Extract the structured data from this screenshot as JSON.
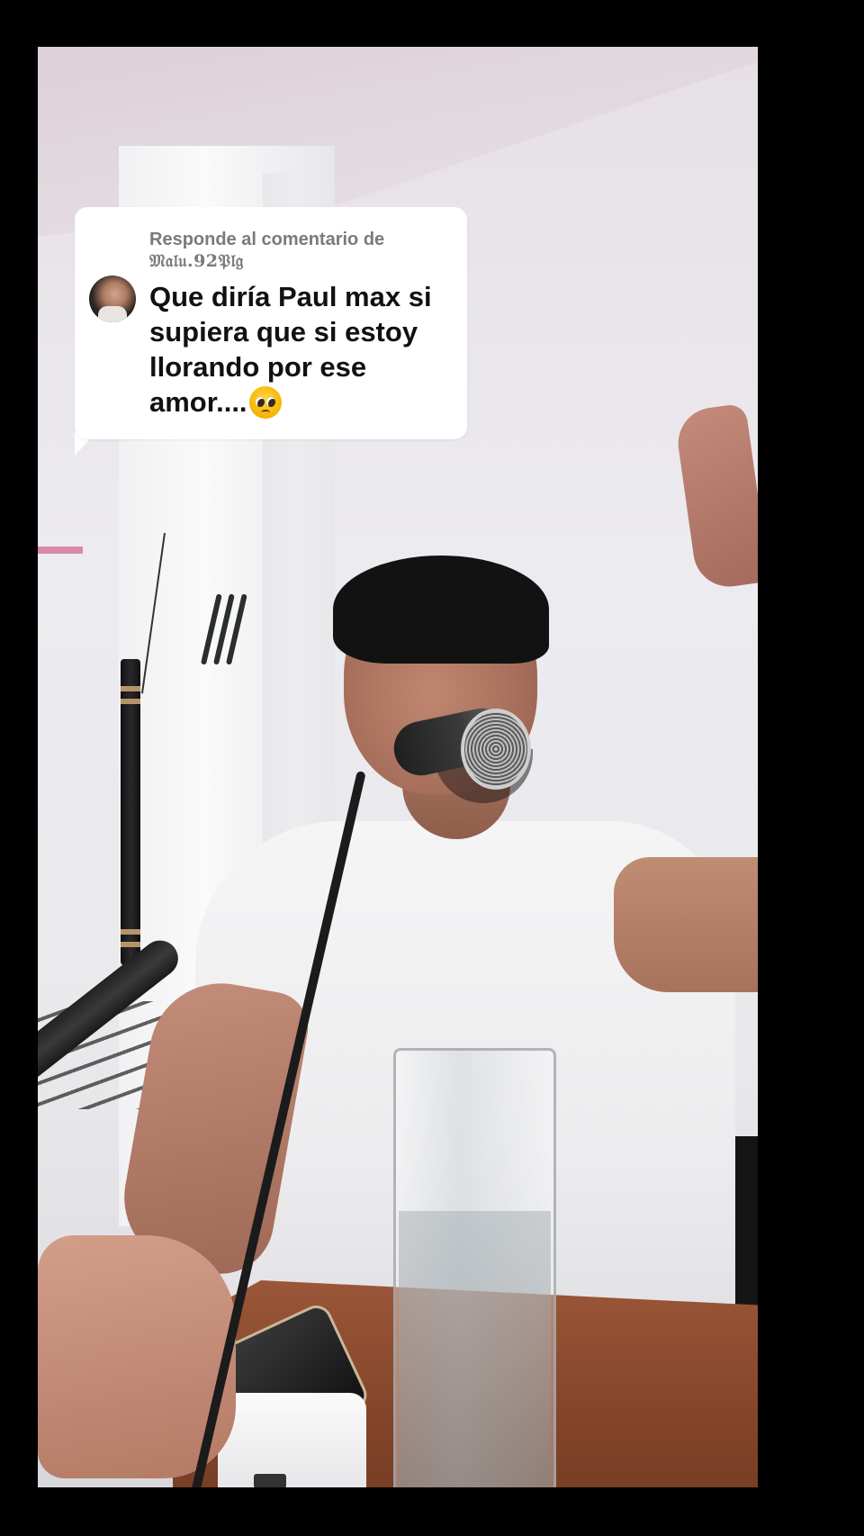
{
  "reply": {
    "header": "Responde al comentario de",
    "username": "𝔐𝔞𝔩𝔲.92𝔓𝔩𝔤",
    "comment": "Que diría Paul max si supiera que si estoy llorando por ese amor....",
    "emoji": "pleading-face"
  },
  "colors": {
    "letterbox": "#000000",
    "bubble": "#ffffff",
    "header_text": "#7a7a7a",
    "comment_text": "#111111"
  }
}
